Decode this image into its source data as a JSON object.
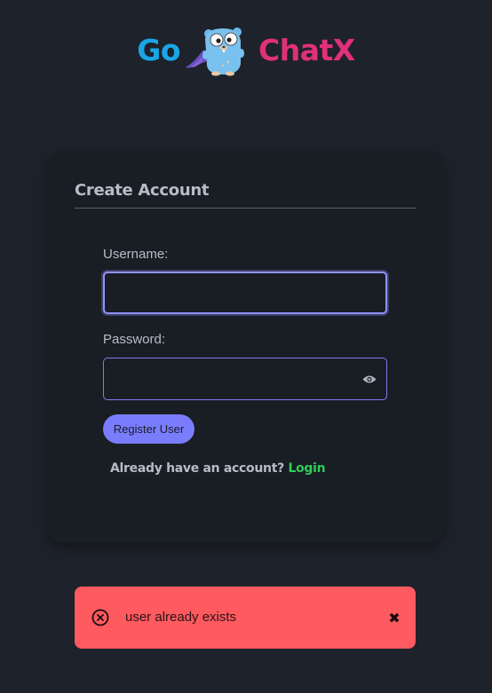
{
  "logo": {
    "left_text": "Go",
    "right_text": "ChatX",
    "mascot": "gopher-mascot-icon"
  },
  "form": {
    "title": "Create Account",
    "username_label": "Username:",
    "username_value": "",
    "password_label": "Password:",
    "password_value": "",
    "show_password_icon": "eye-icon",
    "submit_label": "Register User",
    "footer_text": "Already have an account? ",
    "footer_link": "Login"
  },
  "toast": {
    "icon": "error-circle-x-icon",
    "message": "user already exists",
    "close_icon": "close-x-icon"
  },
  "colors": {
    "background": "#1e222b",
    "card": "#191d24",
    "accent": "#7a7dfb",
    "logo_go": "#1aa5e6",
    "logo_chatx": "#e1307a",
    "link": "#2ecc58",
    "error": "#ff5a5f"
  }
}
